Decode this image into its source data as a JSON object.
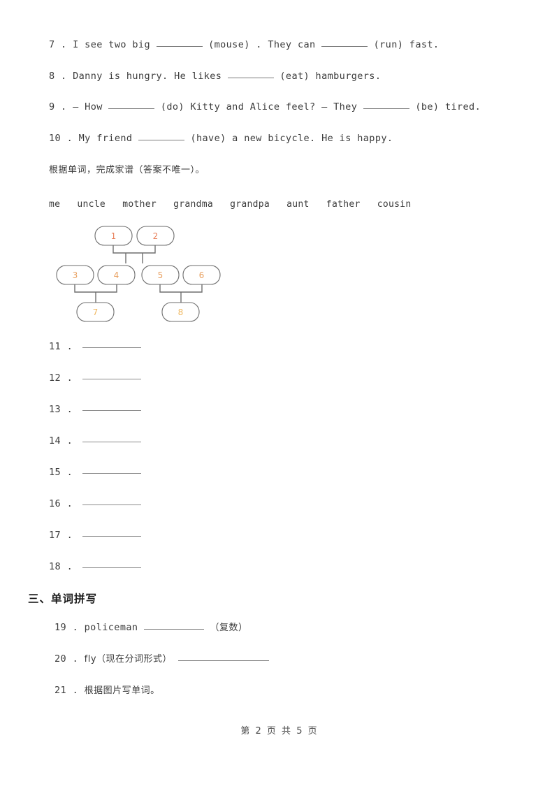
{
  "page": {
    "footer_text": "第 2 页 共 5 页",
    "page_number": "2",
    "total_pages": "5"
  },
  "fill_in_questions": [
    {
      "number": "7 .",
      "seg1": "I see two big",
      "seg2": "(mouse) . They can",
      "seg3": "(run) fast."
    },
    {
      "number": "8 .",
      "seg1": "Danny is hungry. He likes",
      "seg2": "(eat) hamburgers.",
      "seg3": ""
    },
    {
      "number": "9 .",
      "seg1": "— How",
      "seg2": "(do) Kitty and Alice feel?   — They",
      "seg3": "(be) tired."
    },
    {
      "number": "10 .",
      "seg1": "My friend",
      "seg2": "(have) a new bicycle. He is happy.",
      "seg3": ""
    }
  ],
  "family_tree_task": {
    "instruction": "根据单词，完成家谱（答案不唯一）。",
    "word_bank": [
      "me",
      "uncle",
      "mother",
      "grandma",
      "grandpa",
      "aunt",
      "father",
      "cousin"
    ],
    "diagram": {
      "type": "family-tree",
      "nodes": [
        {
          "id": "1",
          "label": "1",
          "row": 1,
          "color": "#E8805A"
        },
        {
          "id": "2",
          "label": "2",
          "row": 1,
          "color": "#E8805A"
        },
        {
          "id": "3",
          "label": "3",
          "row": 2,
          "color": "#E8A060"
        },
        {
          "id": "4",
          "label": "4",
          "row": 2,
          "color": "#E8A060"
        },
        {
          "id": "5",
          "label": "5",
          "row": 2,
          "color": "#E8A060"
        },
        {
          "id": "6",
          "label": "6",
          "row": 2,
          "color": "#E8A060"
        },
        {
          "id": "7",
          "label": "7",
          "row": 3,
          "color": "#F0B860"
        },
        {
          "id": "8",
          "label": "8",
          "row": 3,
          "color": "#F0B860"
        }
      ],
      "couples": [
        [
          "1",
          "2"
        ],
        [
          "3",
          "4"
        ],
        [
          "5",
          "6"
        ]
      ],
      "children": {
        "1-2": [
          "4",
          "5"
        ],
        "3-4": [
          "7"
        ],
        "5-6": [
          "8"
        ]
      }
    }
  },
  "answer_blanks": [
    {
      "number": "11 ."
    },
    {
      "number": "12 ."
    },
    {
      "number": "13 ."
    },
    {
      "number": "14 ."
    },
    {
      "number": "15 ."
    },
    {
      "number": "16 ."
    },
    {
      "number": "17 ."
    },
    {
      "number": "18 ."
    }
  ],
  "spelling_section": {
    "heading": "三、单词拼写",
    "items": [
      {
        "number": "19 .",
        "text_before": "policeman",
        "text_after": "（复数）",
        "has_blank": true
      },
      {
        "number": "20 .",
        "text_before": "fly（现在分词形式）",
        "text_after": "",
        "has_blank": true
      },
      {
        "number": "21 .",
        "text_before": "根据图片写单词。",
        "text_after": "",
        "has_blank": false
      }
    ]
  }
}
